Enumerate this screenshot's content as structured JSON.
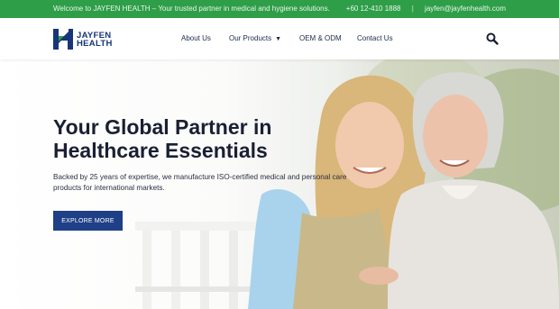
{
  "topbar": {
    "welcome": "Welcome to JAYFEN HEALTH – Your trusted partner in medical and hygiene solutions.",
    "phone": "+60 12-410 1888",
    "separator": "|",
    "email": "jayfen@jayfenhealth.com"
  },
  "brand": {
    "line1": "JAYFEN",
    "line2": "HEALTH",
    "color": "#17357a"
  },
  "nav": {
    "items": [
      "About Us",
      "Our Products",
      "OEM & ODM",
      "Contact Us"
    ],
    "dropdown_icon": "chevron-down-icon",
    "search_icon": "search-icon"
  },
  "hero": {
    "title": "Your Global Partner in Healthcare Essentials",
    "subtitle": "Backed by 25 years of expertise, we manufacture ISO-certified medical and personal care products for international markets.",
    "cta_label": "EXPLORE MORE"
  },
  "colors": {
    "topbar": "#2e9e48",
    "button": "#1f3f86",
    "title": "#1b1f33"
  }
}
